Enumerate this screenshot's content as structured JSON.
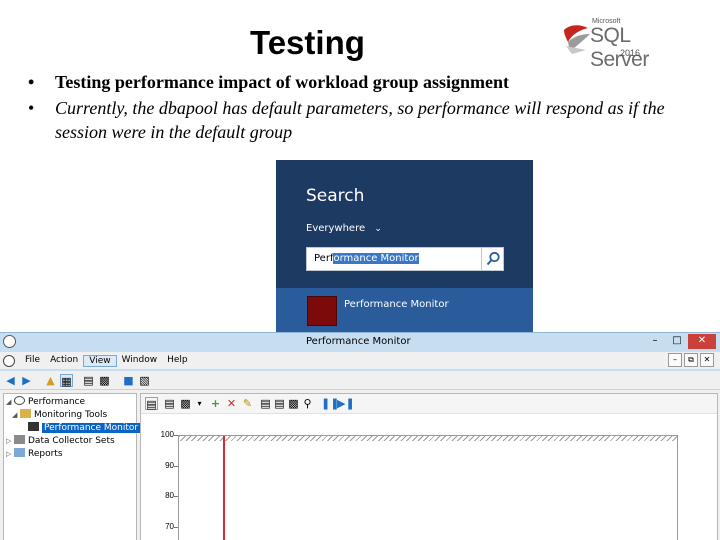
{
  "slide": {
    "title": "Testing",
    "bullets": [
      "Testing performance impact of workload group assignment",
      "Currently, the dbapool has default parameters, so performance will respond as if the session were in the default group"
    ],
    "logo": {
      "maker": "Microsoft",
      "product": "SQL Server",
      "version": "2016"
    }
  },
  "search": {
    "title": "Search",
    "scope": "Everywhere",
    "query_prefix": "Perf",
    "query_selected": "ormance Monitor",
    "result_label": "Performance Monitor",
    "colors": {
      "pane": "#1d3a63",
      "result_bg": "#2a5c9c",
      "tile": "#7d0a0a"
    }
  },
  "perfmon": {
    "window_title": "Performance Monitor",
    "menus": [
      "File",
      "Action",
      "View",
      "Window",
      "Help"
    ],
    "active_menu": "View",
    "tree": {
      "root": "Performance",
      "monitoring_tools": "Monitoring Tools",
      "performance_monitor": "Performance Monitor",
      "data_collector_sets": "Data Collector Sets",
      "reports": "Reports"
    },
    "graph": {
      "y_ticks": [
        "100",
        "90",
        "80",
        "70"
      ],
      "cursor_color": "#d42a2a"
    }
  }
}
